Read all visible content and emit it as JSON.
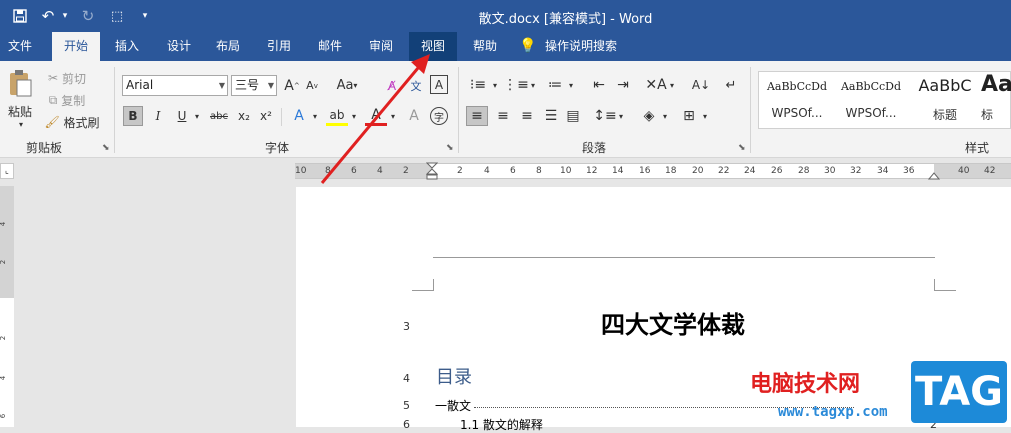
{
  "window": {
    "title": "散文.docx [兼容模式]  -  Word"
  },
  "qat": {
    "undo_arrow": "▾",
    "customize": "▾"
  },
  "tabs": [
    "文件",
    "开始",
    "插入",
    "设计",
    "布局",
    "引用",
    "邮件",
    "审阅",
    "视图",
    "帮助"
  ],
  "tell_me": "操作说明搜索",
  "clipboard": {
    "paste": "粘贴",
    "cut": "剪切",
    "copy": "复制",
    "format_painter": "格式刷",
    "label": "剪贴板"
  },
  "font": {
    "name": "Arial",
    "size": "三号",
    "label": "字体",
    "bold": "B",
    "italic": "I",
    "underline": "U",
    "strike": "abc",
    "sub": "x₂",
    "sup": "x²",
    "grow": "A",
    "shrink": "A",
    "case": "Aa",
    "wen": "文",
    "box": "A",
    "phon": "字"
  },
  "paragraph": {
    "label": "段落"
  },
  "styles": {
    "label": "样式",
    "items": [
      {
        "preview": "AaBbCcDd",
        "name": "WPSOf..."
      },
      {
        "preview": "AaBbCcDd",
        "name": "WPSOf..."
      },
      {
        "preview": "AaBbC",
        "name": "标题"
      },
      {
        "preview": "Aa",
        "name": "标"
      }
    ]
  },
  "ruler": {
    "left": [
      "10",
      "8",
      "6",
      "4",
      "2"
    ],
    "right": [
      "2",
      "4",
      "6",
      "8",
      "10",
      "12",
      "14",
      "16",
      "18",
      "20",
      "22",
      "24",
      "26",
      "28",
      "30",
      "32",
      "34",
      "36",
      "40",
      "42"
    ],
    "vertical": [
      "4",
      "2",
      "2",
      "4",
      "6"
    ]
  },
  "doc": {
    "line_numbers": [
      "3",
      "4",
      "5",
      "6"
    ],
    "title": "四大文学体裁",
    "toc_heading": "目录",
    "toc_item1": "一散文",
    "toc_item2": "1.1 散文的解释",
    "toc_page": "2"
  },
  "watermark": {
    "site": "电脑技术网",
    "url": "www.tagxp.com",
    "tag": "TAG"
  },
  "colors": {
    "accent": "#2b579a",
    "highlight_tab": "#124078",
    "arrow": "#e02020"
  }
}
